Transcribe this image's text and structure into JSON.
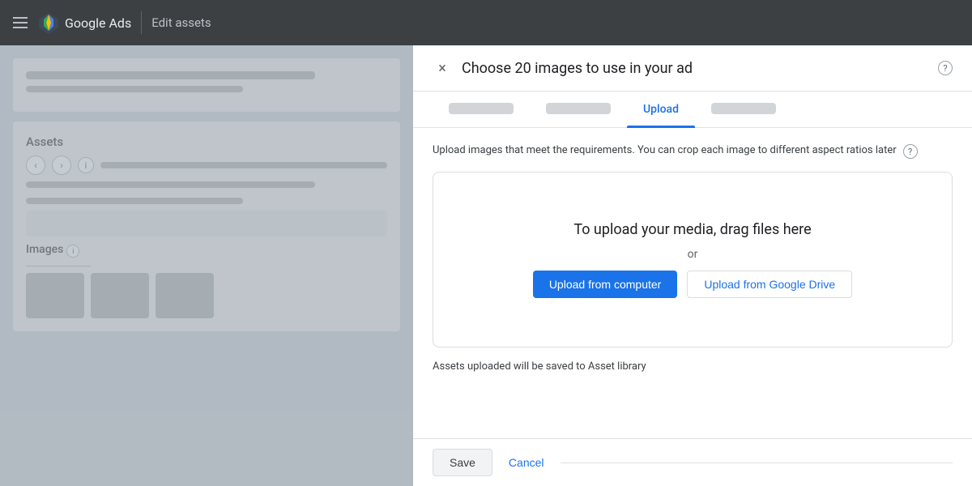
{
  "topbar": {
    "title": "Google Ads",
    "section": "Edit assets"
  },
  "dialog": {
    "title": "Choose 20 images to use in your ad",
    "close_label": "×",
    "help_label": "?",
    "tabs": [
      {
        "id": "tab1",
        "label": "",
        "type": "placeholder"
      },
      {
        "id": "tab2",
        "label": "",
        "type": "placeholder"
      },
      {
        "id": "tab3",
        "label": "Upload",
        "type": "active"
      },
      {
        "id": "tab4",
        "label": "",
        "type": "placeholder"
      }
    ],
    "info_text": "Upload images that meet the requirements. You can crop each image to different aspect ratios later",
    "dropzone": {
      "drag_text": "To upload your media, drag files here",
      "or_text": "or",
      "btn_computer": "Upload from computer",
      "btn_gdrive": "Upload from Google Drive"
    },
    "asset_note": "Assets uploaded will be saved to Asset library",
    "footer": {
      "save_label": "Save",
      "cancel_label": "Cancel"
    }
  },
  "left_panel": {
    "assets_label": "Assets",
    "images_label": "Images"
  }
}
